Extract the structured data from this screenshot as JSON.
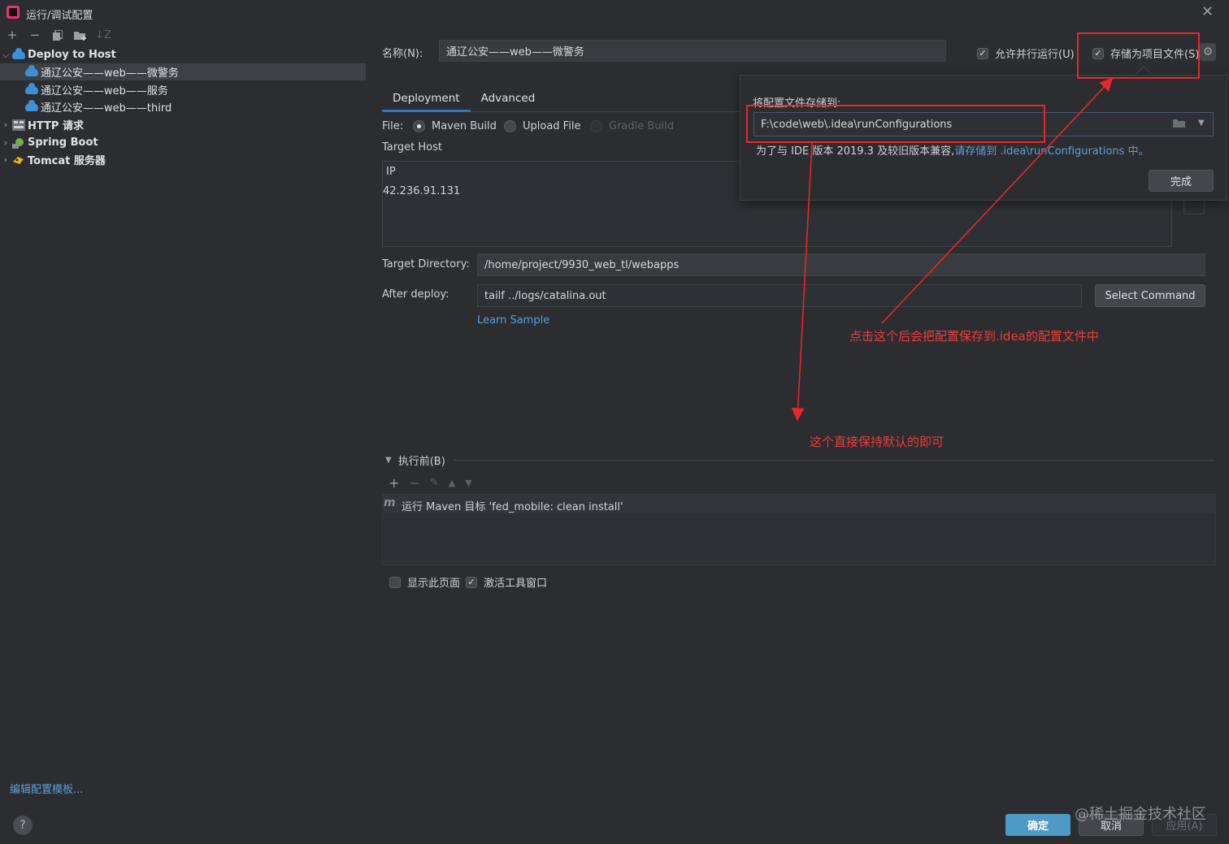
{
  "window": {
    "title": "运行/调试配置",
    "close_glyph": "✕"
  },
  "toolbar": {
    "icons": [
      "plus-icon",
      "minus-icon",
      "copy-icon",
      "folder-add-icon",
      "sort-icon"
    ]
  },
  "tree": {
    "deploy_group": "Deploy to Host",
    "items": [
      "通辽公安——web——微警务",
      "通辽公安——web——服务",
      "通辽公安——web——third"
    ],
    "http_group": "HTTP 请求",
    "spring_group": "Spring Boot",
    "tomcat_group": "Tomcat 服务器"
  },
  "edit_template_link": "编辑配置模板...",
  "help_glyph": "?",
  "form": {
    "name_label": "名称(N):",
    "name_value": "通辽公安——web——微警务",
    "allow_parallel_label": "允许并行运行(U)",
    "allow_parallel_checked": true,
    "store_as_project_label": "存储为项目文件(S)",
    "store_as_project_checked": true,
    "tabs": [
      "Deployment",
      "Advanced"
    ],
    "file_label": "File:",
    "file_options": [
      "Maven Build",
      "Upload File",
      "Gradle Build"
    ],
    "file_selected": "Maven Build",
    "target_host_label": "Target Host",
    "host_col_header": "IP",
    "host_ip": "42.236.91.131",
    "target_dir_label": "Target Directory:",
    "target_dir_value": "/home/project/9930_web_tl/webapps",
    "after_deploy_label": "After deploy:",
    "after_deploy_value": "tailf ../logs/catalina.out",
    "select_command_label": "Select Command",
    "learn_sample_label": "Learn Sample"
  },
  "before_launch": {
    "header": "执行前(B)",
    "task": "运行 Maven 目标 'fed_mobile: clean install'",
    "show_page_label": "显示此页面",
    "show_page_checked": false,
    "activate_tool_label": "激活工具窗口",
    "activate_tool_checked": true
  },
  "popup": {
    "title": "将配置文件存储到:",
    "path_value": "F:\\code\\web\\.idea\\runConfigurations",
    "note_prefix": "为了与 IDE 版本 2019.3 及较旧版本兼容,",
    "note_link": "请存储到 .idea\\runConfigurations 中。",
    "done_label": "完成"
  },
  "annotations": {
    "note1": "点击这个后会把配置保存到.idea的配置文件中",
    "note2": "这个直接保持默认的即可"
  },
  "footer": {
    "ok_label": "确定",
    "cancel_label": "取消",
    "apply_label": "应用(A)"
  },
  "watermark": "@稀土掘金技术社区",
  "colors": {
    "accent": "#3574c4",
    "annotation_red": "#e8262b",
    "link": "#5d9fd6"
  }
}
